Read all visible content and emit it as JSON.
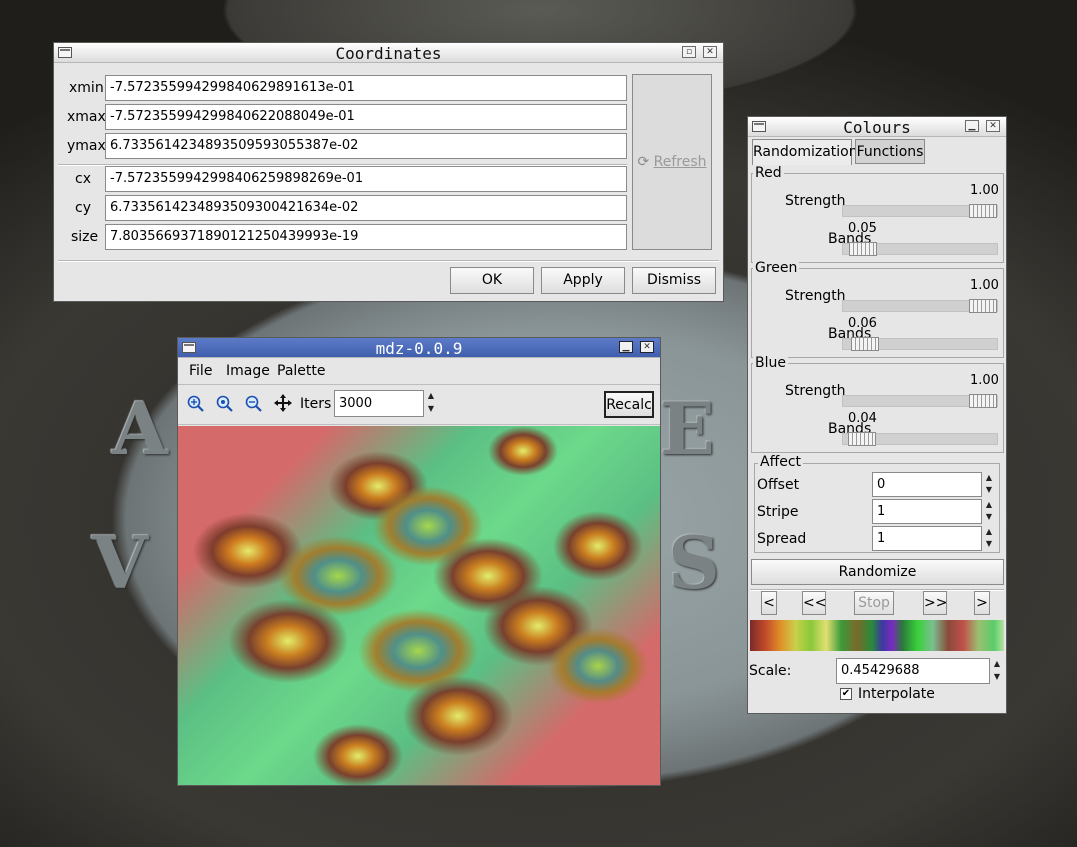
{
  "coords_window": {
    "title": "Coordinates",
    "fields": [
      {
        "label": "xmin",
        "value": "-7.5723559942998406298916​13e-01"
      },
      {
        "label": "xmax",
        "value": "-7.57235599429984062208804 9e-01"
      },
      {
        "label": "ymax",
        "value": "6.733561423489350959305538 7e-02"
      },
      {
        "label": "cx",
        "value": "-7.5723559942998406259898269e-01"
      },
      {
        "label": "cy",
        "value": "6.7335614234893509300421634e-02"
      },
      {
        "label": "size",
        "value": "7.8035669371890121250439993e-19"
      }
    ],
    "refresh_label": "Refresh",
    "ok_label": "OK",
    "apply_label": "Apply",
    "dismiss_label": "Dismiss"
  },
  "mdz_window": {
    "title": "mdz-0.0.9",
    "menu": [
      "File",
      "Image",
      "Palette"
    ],
    "iters_label": "Iters",
    "iters_value": "3000",
    "recalc_label": "Recalc",
    "icons": [
      "zoom-in-icon",
      "zoom-icon",
      "zoom-out-icon",
      "move-icon"
    ]
  },
  "colours_window": {
    "title": "Colours",
    "tabs": [
      "Randomization",
      "Functions"
    ],
    "channels": [
      {
        "name": "Red",
        "strength_label": "Strength",
        "strength": "1.00",
        "strength_value": 1.0,
        "bands_label": "Bands",
        "bands": "0.05",
        "bands_value": 0.05
      },
      {
        "name": "Green",
        "strength_label": "Strength",
        "strength": "1.00",
        "strength_value": 1.0,
        "bands_label": "Bands",
        "bands": "0.06",
        "bands_value": 0.06
      },
      {
        "name": "Blue",
        "strength_label": "Strength",
        "strength": "1.00",
        "strength_value": 1.0,
        "bands_label": "Bands",
        "bands": "0.04",
        "bands_value": 0.04
      }
    ],
    "affect": {
      "title": "Affect",
      "rows": [
        {
          "label": "Offset",
          "value": "0"
        },
        {
          "label": "Stripe",
          "value": "1"
        },
        {
          "label": "Spread",
          "value": "1"
        }
      ]
    },
    "randomize_label": "Randomize",
    "nav": [
      "<",
      "<<",
      "Stop",
      ">>",
      ">"
    ],
    "scale_label": "Scale:",
    "scale_value": "0.45429688",
    "interpolate_label": "Interpolate",
    "interpolate_checked": true
  },
  "colors": {
    "titlebar_active": "#4566b5",
    "fractal_green": "#57c47c",
    "fractal_pink": "#d16a6a"
  }
}
